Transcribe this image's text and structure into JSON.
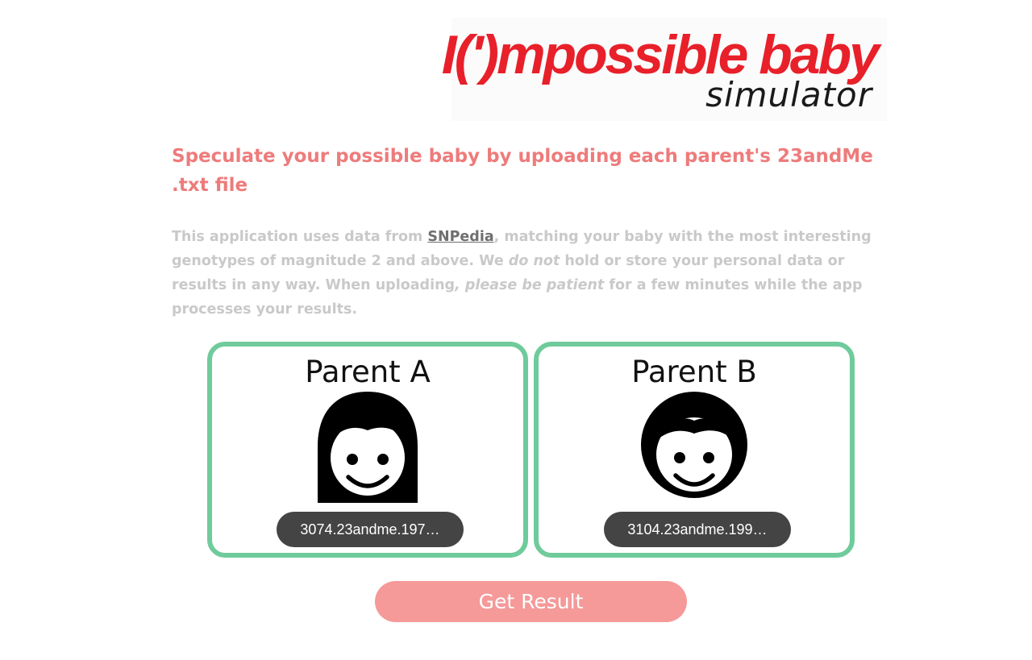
{
  "logo": {
    "main": "I(')mpossible baby",
    "sub": "simulator",
    "color": "#e8202a"
  },
  "headline": "Speculate your possible baby by uploading each parent's 23andMe .txt file",
  "intro": {
    "part1": "This application uses data from ",
    "link_text": "SNPedia",
    "part2": ", matching your baby with the most interesting genotypes of magnitude 2 and above. We ",
    "emphasis1": "do not",
    "part3": " hold or store your personal data or results in any way. When uploading",
    "comma": ",",
    "emphasis2": "please be patient",
    "part4": " for a few minutes while the app processes your results."
  },
  "parents": [
    {
      "title": "Parent A",
      "icon": "woman-long-hair-icon",
      "file_name": "3074.23andme.197…"
    },
    {
      "title": "Parent B",
      "icon": "woman-short-hair-icon",
      "file_name": "3104.23andme.199…"
    }
  ],
  "actions": {
    "get_result_label": "Get Result"
  },
  "colors": {
    "headline": "#ee7b7b",
    "intro_text": "#c9c9c9",
    "card_border": "#6fcb9b",
    "file_pill": "#444444",
    "button": "#f59999"
  }
}
